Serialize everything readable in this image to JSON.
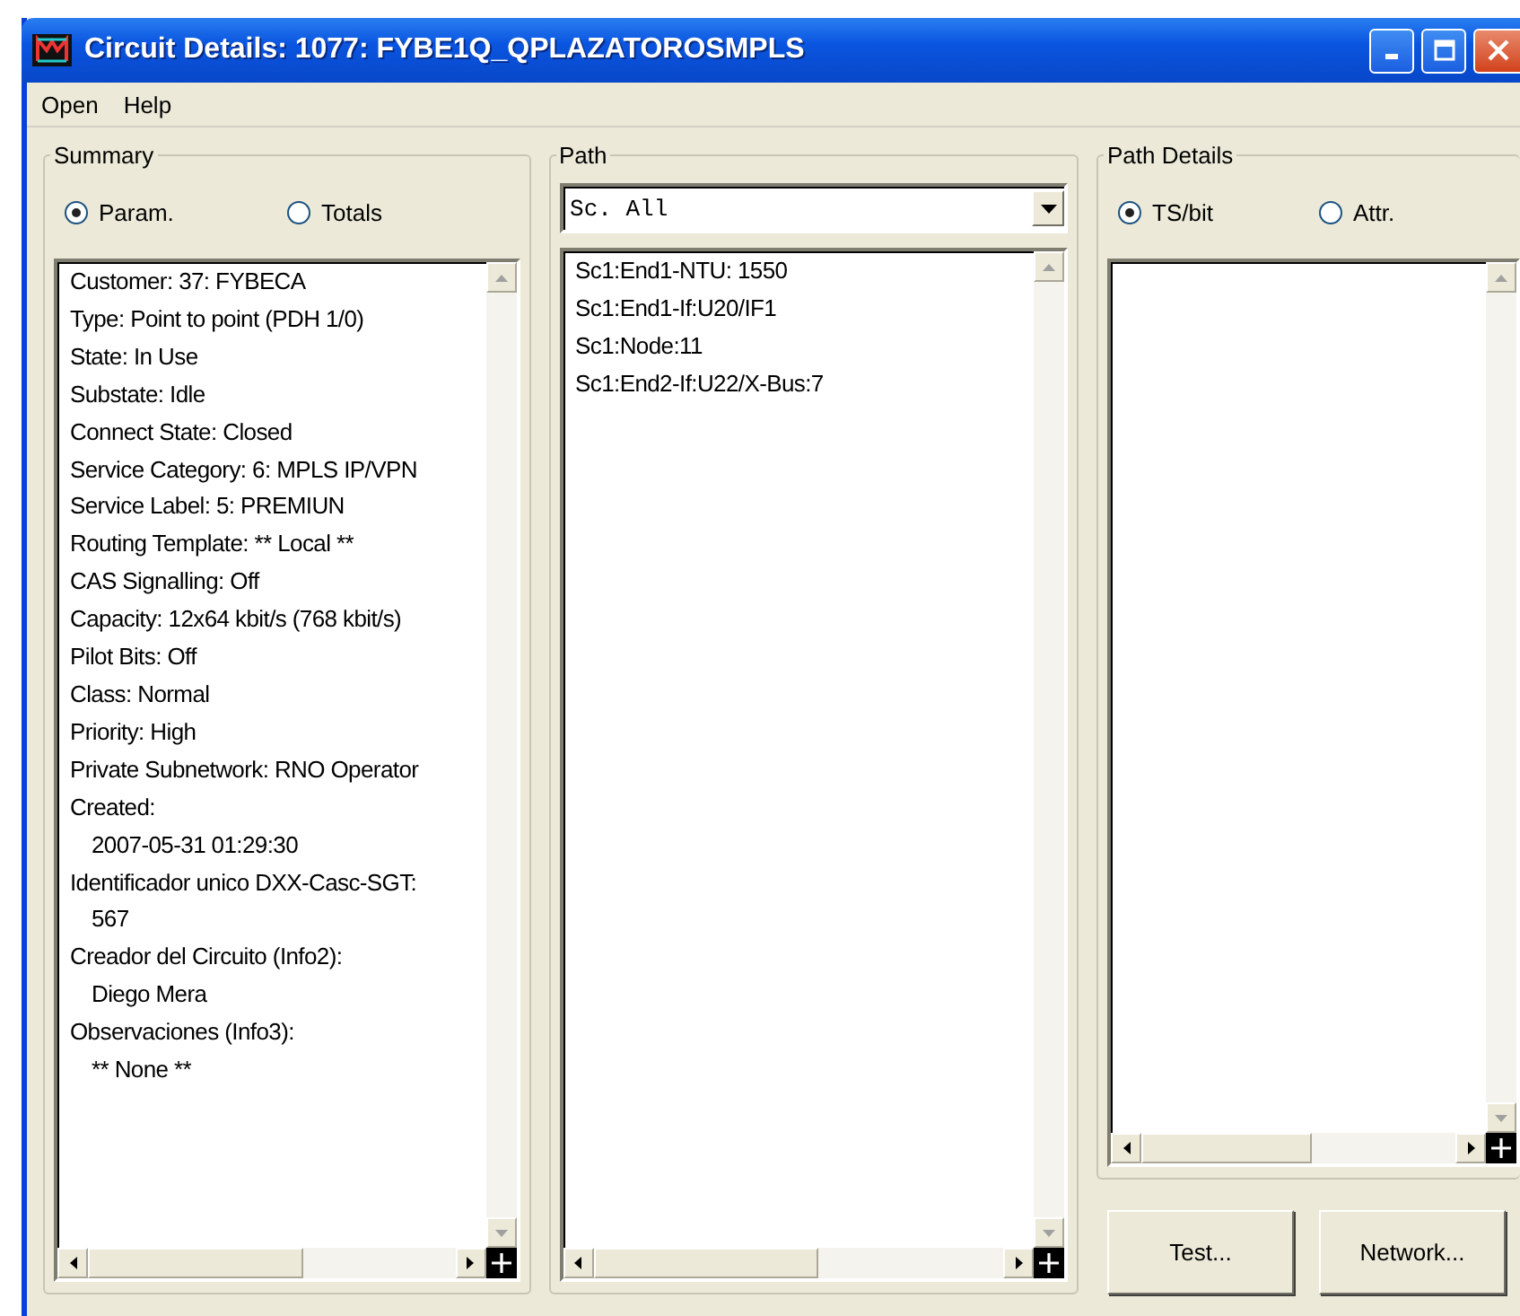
{
  "window": {
    "title": "Circuit Details: 1077: FYBE1Q_QPLAZATOROSMPLS"
  },
  "menu": [
    "Open",
    "Help"
  ],
  "summary": {
    "title": "Summary",
    "options": [
      {
        "label": "Param.",
        "selected": true
      },
      {
        "label": "Totals",
        "selected": false
      }
    ],
    "lines": [
      {
        "text": "Customer: 37: FYBECA",
        "kind": "label"
      },
      {
        "text": "Type: Point to point (PDH 1/0)",
        "kind": "label"
      },
      {
        "text": "State: In Use",
        "kind": "label"
      },
      {
        "text": "Substate: Idle",
        "kind": "label"
      },
      {
        "text": "Connect State: Closed",
        "kind": "label"
      },
      {
        "text": "Service Category: 6: MPLS IP/VPN",
        "kind": "label"
      },
      {
        "text": "Service Label: 5: PREMIUN",
        "kind": "label"
      },
      {
        "text": "Routing Template: ** Local **",
        "kind": "label"
      },
      {
        "text": "CAS Signalling: Off",
        "kind": "label"
      },
      {
        "text": "Capacity: 12x64 kbit/s (768 kbit/s)",
        "kind": "label"
      },
      {
        "text": "Pilot Bits: Off",
        "kind": "label"
      },
      {
        "text": "Class: Normal",
        "kind": "label"
      },
      {
        "text": "Priority: High",
        "kind": "label"
      },
      {
        "text": "Private Subnetwork: RNO Operator",
        "kind": "label"
      },
      {
        "text": "Created:",
        "kind": "label"
      },
      {
        "text": "2007-05-31 01:29:30",
        "kind": "value"
      },
      {
        "text": "Identificador unico DXX-Casc-SGT:",
        "kind": "label"
      },
      {
        "text": "567",
        "kind": "value"
      },
      {
        "text": "Creador del Circuito (Info2):",
        "kind": "label"
      },
      {
        "text": "Diego Mera",
        "kind": "value"
      },
      {
        "text": "Observaciones (Info3):",
        "kind": "label"
      },
      {
        "text": "** None **",
        "kind": "value"
      }
    ]
  },
  "path": {
    "title": "Path",
    "dropdown": {
      "value": "Sc. All"
    },
    "items": [
      "Sc1:End1-NTU: 1550",
      "Sc1:End1-If:U20/IF1",
      "Sc1:Node:11",
      "Sc1:End2-If:U22/X-Bus:7"
    ]
  },
  "path_details": {
    "title": "Path Details",
    "options": [
      {
        "label": "TS/bit",
        "selected": true
      },
      {
        "label": "Attr.",
        "selected": false
      }
    ]
  },
  "buttons": [
    "Test...",
    "Network..."
  ]
}
